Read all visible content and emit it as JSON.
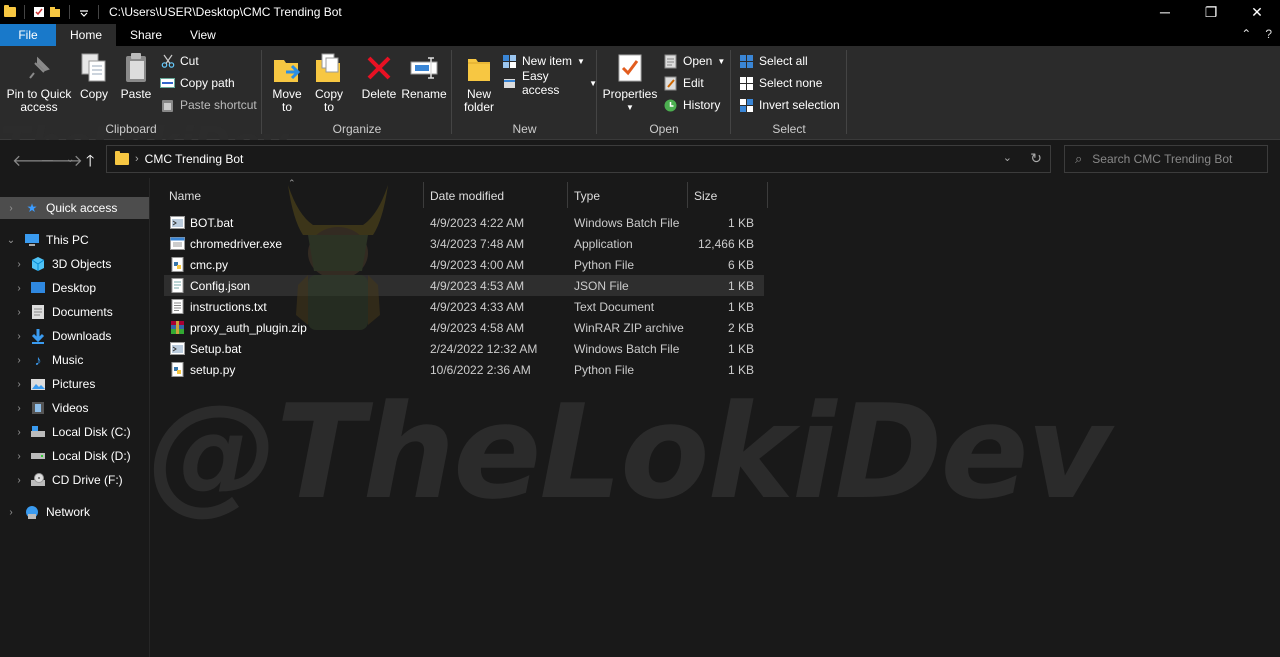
{
  "titlebar": {
    "path": "C:\\Users\\USER\\Desktop\\CMC Trending Bot",
    "minimize": "─",
    "maximize": "❐",
    "close": "✕"
  },
  "tabs": {
    "file": "File",
    "home": "Home",
    "share": "Share",
    "view": "View",
    "collapse": "⌃",
    "help": "?"
  },
  "ribbon": {
    "clipboard": {
      "label": "Clipboard",
      "pin_l1": "Pin to Quick",
      "pin_l2": "access",
      "copy": "Copy",
      "paste": "Paste",
      "cut": "Cut",
      "copy_path": "Copy path",
      "paste_shortcut": "Paste shortcut"
    },
    "organize": {
      "label": "Organize",
      "move_l1": "Move",
      "move_l2": "to",
      "copy_l1": "Copy",
      "copy_l2": "to",
      "delete": "Delete",
      "rename": "Rename"
    },
    "new": {
      "label": "New",
      "folder_l1": "New",
      "folder_l2": "folder",
      "new_item": "New item",
      "easy_access": "Easy access"
    },
    "open": {
      "label": "Open",
      "properties": "Properties",
      "open": "Open",
      "edit": "Edit",
      "history": "History"
    },
    "select": {
      "label": "Select",
      "select_all": "Select all",
      "select_none": "Select none",
      "invert": "Invert selection"
    }
  },
  "address": {
    "crumb": "CMC Trending Bot"
  },
  "search": {
    "placeholder": "Search CMC Trending Bot"
  },
  "navpane": {
    "quick_access": "Quick access",
    "this_pc": "This PC",
    "items": [
      "3D Objects",
      "Desktop",
      "Documents",
      "Downloads",
      "Music",
      "Pictures",
      "Videos",
      "Local Disk (C:)",
      "Local Disk (D:)",
      "CD Drive (F:)"
    ],
    "network": "Network"
  },
  "columns": {
    "name": "Name",
    "date": "Date modified",
    "type": "Type",
    "size": "Size"
  },
  "files": [
    {
      "name": "BOT.bat",
      "date": "4/9/2023 4:22 AM",
      "type": "Windows Batch File",
      "size": "1 KB"
    },
    {
      "name": "chromedriver.exe",
      "date": "3/4/2023 7:48 AM",
      "type": "Application",
      "size": "12,466 KB"
    },
    {
      "name": "cmc.py",
      "date": "4/9/2023 4:00 AM",
      "type": "Python File",
      "size": "6 KB"
    },
    {
      "name": "Config.json",
      "date": "4/9/2023 4:53 AM",
      "type": "JSON File",
      "size": "1 KB"
    },
    {
      "name": "instructions.txt",
      "date": "4/9/2023 4:33 AM",
      "type": "Text Document",
      "size": "1 KB"
    },
    {
      "name": "proxy_auth_plugin.zip",
      "date": "4/9/2023 4:58 AM",
      "type": "WinRAR ZIP archive",
      "size": "2 KB"
    },
    {
      "name": "Setup.bat",
      "date": "2/24/2022 12:32 AM",
      "type": "Windows Batch File",
      "size": "1 KB"
    },
    {
      "name": "setup.py",
      "date": "10/6/2022 2:36 AM",
      "type": "Python File",
      "size": "1 KB"
    }
  ],
  "watermark": {
    "big": "@TheLokiDev",
    "small": "TheLokiDev"
  }
}
